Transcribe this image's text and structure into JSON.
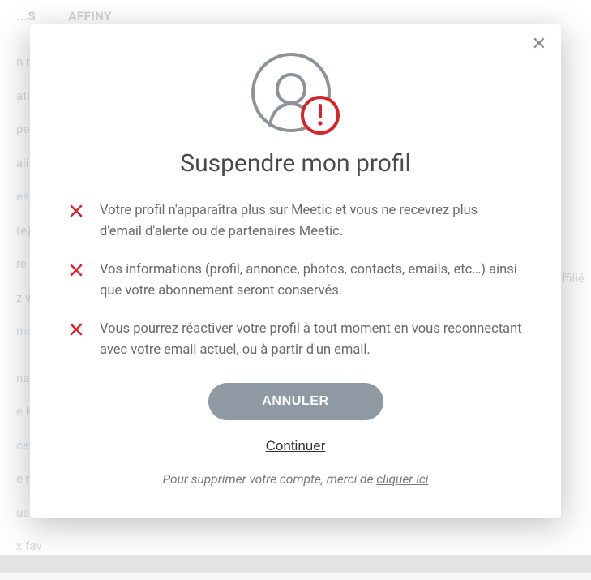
{
  "bg": {
    "tab1": "...S",
    "tab2": "AFFINY",
    "lines": [
      {
        "text": "n me",
        "cls": ""
      },
      {
        "text": "atif c",
        "cls": ""
      },
      {
        "text": "pers",
        "cls": ""
      },
      {
        "text": "alité",
        "cls": ""
      },
      {
        "text": "es c",
        "cls": "bg-blue"
      },
      {
        "text": "(e) a",
        "cls": ""
      },
      {
        "text": "re p",
        "cls": ""
      },
      {
        "text": "z vo",
        "cls": ""
      },
      {
        "text": "mo",
        "cls": "bg-blue"
      },
      {
        "text": "nain",
        "cls": ""
      },
      {
        "text": "e Me",
        "cls": ""
      },
      {
        "text": "catio",
        "cls": "bg-blue"
      },
      {
        "text": "e reç",
        "cls": ""
      },
      {
        "text": "ues",
        "cls": ""
      },
      {
        "text": "x fav",
        "cls": ""
      }
    ],
    "right": "affilié"
  },
  "modal": {
    "title": "Suspendre mon profil",
    "items": [
      "Votre profil n'apparaîtra plus sur Meetic et vous ne recevrez plus d'email d'alerte ou de partenaires Meetic.",
      "Vos informations (profil, annonce, photos, contacts, emails, etc…) ainsi que votre abonnement seront conservés.",
      "Vous pourrez réactiver votre profil à tout moment en vous reconnectant avec votre email actuel, ou à partir d'un email."
    ],
    "cancel": "ANNULER",
    "continue": "Continuer",
    "deletePrefix": "Pour supprimer votre compte, merci de ",
    "deleteLink": "cliquer ici"
  }
}
